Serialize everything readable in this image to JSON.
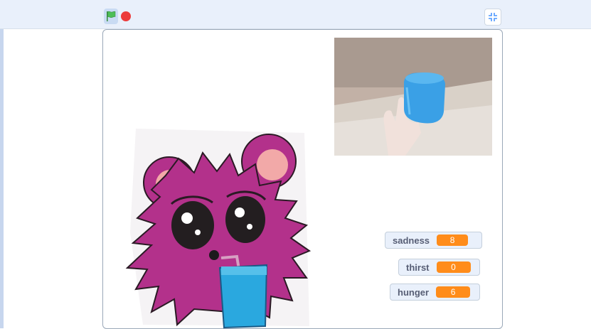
{
  "toolbar": {
    "green_flag_icon": "green-flag-icon",
    "stop_icon": "stop-icon",
    "fullscreen_icon": "fullscreen-exit-icon"
  },
  "stage": {
    "sprite": "monster-with-drink",
    "camera": "webcam-video-blue-cup"
  },
  "monitors": [
    {
      "label": "sadness",
      "value": "8"
    },
    {
      "label": "thirst",
      "value": "0"
    },
    {
      "label": "hunger",
      "value": "6"
    }
  ],
  "colors": {
    "monitor_value": "#ff8c1a",
    "monitor_label": "#575e75",
    "stop": "#ec3b3b",
    "flag": "#4cbf56"
  }
}
